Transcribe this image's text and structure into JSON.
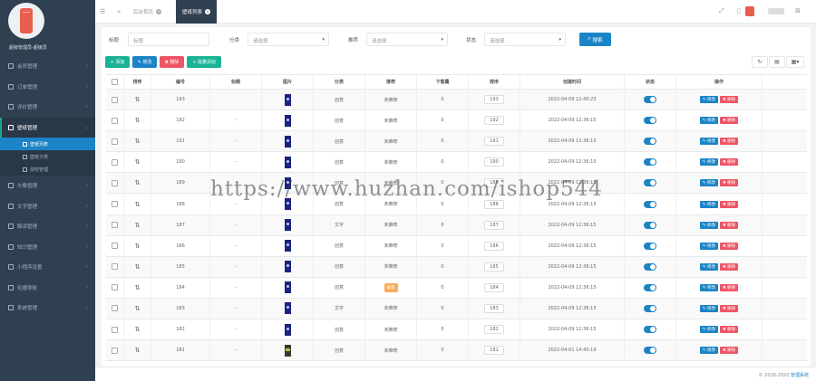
{
  "sidebar": {
    "user_name": "超级管理员-超级员",
    "menu": [
      {
        "label": "会员管理",
        "icon": "users-icon"
      },
      {
        "label": "订单管理",
        "icon": "order-icon"
      },
      {
        "label": "评价管理",
        "icon": "comment-icon"
      },
      {
        "label": "壁纸管理",
        "icon": "wallpaper-icon",
        "open": true
      },
      {
        "label": "头像管理",
        "icon": "avatar-icon"
      },
      {
        "label": "文字管理",
        "icon": "text-icon"
      },
      {
        "label": "解读管理",
        "icon": "book-icon"
      },
      {
        "label": "知识管理",
        "icon": "knowledge-icon"
      },
      {
        "label": "小程序设置",
        "icon": "settings-icon"
      },
      {
        "label": "轮播导航",
        "icon": "carousel-icon"
      },
      {
        "label": "系统管理",
        "icon": "system-icon"
      }
    ],
    "submenu": [
      "壁纸列表",
      "壁纸分类",
      "授权管理"
    ]
  },
  "topbar": {
    "tabs": [
      "后台首页",
      "壁纸列表"
    ]
  },
  "filters": {
    "title_label": "标题",
    "title_placeholder": "标题",
    "category_label": "分类",
    "category_value": "请选择",
    "recommend_label": "推荐",
    "recommend_value": "请选择",
    "status_label": "状态",
    "status_value": "请选择",
    "search_label": "搜索"
  },
  "toolbar": {
    "add": "+ 添加",
    "edit": "✎ 修改",
    "delete": "✖ 删除",
    "batch_add": "+ 批量添加"
  },
  "table": {
    "headers": [
      "",
      "排序",
      "编号",
      "标题",
      "图片",
      "分类",
      "推荐",
      "下载量",
      "排序",
      "创建时间",
      "状态",
      "操作"
    ],
    "edit_label": "✎ 修改",
    "delete_label": "✖ 删除",
    "rows": [
      {
        "id": "193",
        "title": "",
        "category": "创意",
        "recommend": "未推荐",
        "downloads": "0",
        "sort": "193",
        "created": "2022-04-09 12:40:23"
      },
      {
        "id": "192",
        "title": "-",
        "category": "创意",
        "recommend": "未推荐",
        "downloads": "0",
        "sort": "192",
        "created": "2022-04-09 12:36:15"
      },
      {
        "id": "191",
        "title": "-",
        "category": "创意",
        "recommend": "未推荐",
        "downloads": "0",
        "sort": "191",
        "created": "2022-04-09 12:36:15"
      },
      {
        "id": "190",
        "title": "-",
        "category": "创意",
        "recommend": "未推荐",
        "downloads": "0",
        "sort": "190",
        "created": "2022-04-09 12:36:15"
      },
      {
        "id": "189",
        "title": "-",
        "category": "创意",
        "recommend": "未推荐",
        "downloads": "0",
        "sort": "189",
        "created": "2022-04-09 12:36:15"
      },
      {
        "id": "188",
        "title": "-",
        "category": "创意",
        "recommend": "未推荐",
        "downloads": "0",
        "sort": "188",
        "created": "2022-04-09 12:36:15"
      },
      {
        "id": "187",
        "title": "-",
        "category": "文字",
        "recommend": "未推荐",
        "downloads": "0",
        "sort": "187",
        "created": "2022-04-09 12:36:15"
      },
      {
        "id": "186",
        "title": "-",
        "category": "创意",
        "recommend": "未推荐",
        "downloads": "0",
        "sort": "186",
        "created": "2022-04-09 12:36:15"
      },
      {
        "id": "185",
        "title": "-",
        "category": "创意",
        "recommend": "未推荐",
        "downloads": "0",
        "sort": "185",
        "created": "2022-04-09 12:36:15"
      },
      {
        "id": "184",
        "title": "-",
        "category": "创意",
        "recommend": "推荐",
        "downloads": "0",
        "sort": "184",
        "created": "2022-04-09 12:36:15"
      },
      {
        "id": "183",
        "title": "-",
        "category": "文字",
        "recommend": "未推荐",
        "downloads": "0",
        "sort": "183",
        "created": "2022-04-09 12:36:15"
      },
      {
        "id": "182",
        "title": "-",
        "category": "创意",
        "recommend": "未推荐",
        "downloads": "0",
        "sort": "182",
        "created": "2022-04-09 12:36:15"
      },
      {
        "id": "181",
        "title": "-",
        "category": "创意",
        "recommend": "未推荐",
        "downloads": "0",
        "sort": "181",
        "created": "2022-04-01 14:40:19"
      }
    ]
  },
  "footer": {
    "copyright": "© 2018-2020",
    "link": "管理系统"
  },
  "watermark": "https://www.huzhan.com/ishop544"
}
